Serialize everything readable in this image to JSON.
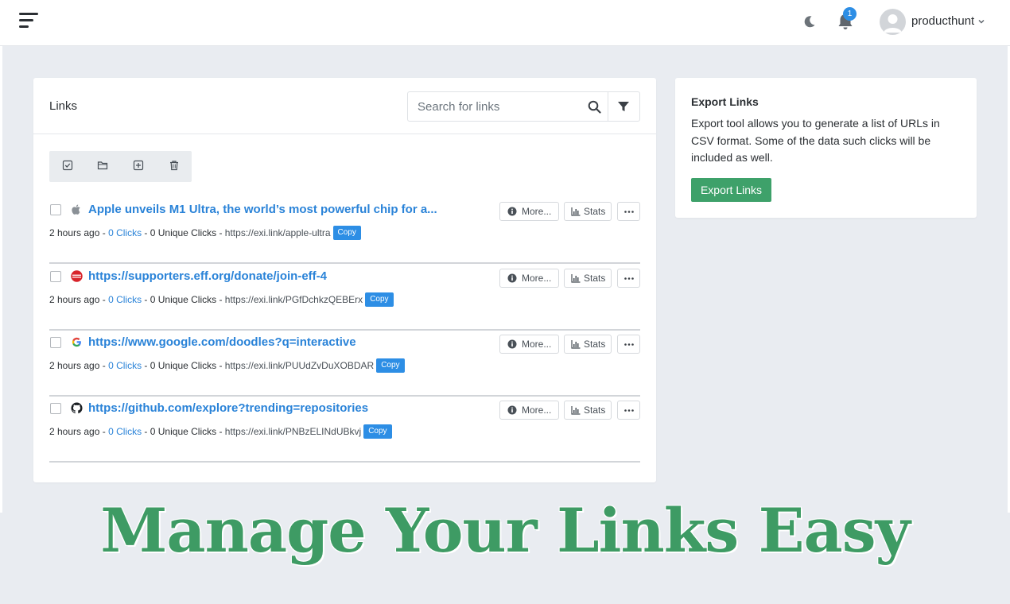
{
  "header": {
    "user_name": "producthunt",
    "notification_count": "1",
    "icons": [
      "menu-icon",
      "moon-icon",
      "bell-icon",
      "avatar",
      "chevron-down-icon"
    ]
  },
  "links_card": {
    "title": "Links",
    "search_placeholder": "Search for links",
    "toolbar_icons": [
      "select-all-icon",
      "folder-icon",
      "add-icon",
      "trash-icon"
    ]
  },
  "links": [
    {
      "title": "Apple unveils M1 Ultra, the world’s most powerful chip for a...",
      "favicon": "apple-icon",
      "time": "2 hours ago",
      "clicks": "0 Clicks",
      "unique": "0 Unique Clicks",
      "short_url": "https://exi.link/apple-ultra",
      "copy_label": "Copy",
      "more_label": "More...",
      "stats_label": "Stats"
    },
    {
      "title": "https://supporters.eff.org/donate/join-eff-4",
      "favicon": "eff-icon",
      "time": "2 hours ago",
      "clicks": "0 Clicks",
      "unique": "0 Unique Clicks",
      "short_url": "https://exi.link/PGfDchkzQEBErx",
      "copy_label": "Copy",
      "more_label": "More...",
      "stats_label": "Stats"
    },
    {
      "title": "https://www.google.com/doodles?q=interactive",
      "favicon": "google-icon",
      "time": "2 hours ago",
      "clicks": "0 Clicks",
      "unique": "0 Unique Clicks",
      "short_url": "https://exi.link/PUUdZvDuXOBDAR",
      "copy_label": "Copy",
      "more_label": "More...",
      "stats_label": "Stats"
    },
    {
      "title": "https://github.com/explore?trending=repositories",
      "favicon": "github-icon",
      "time": "2 hours ago",
      "clicks": "0 Clicks",
      "unique": "0 Unique Clicks",
      "short_url": "https://exi.link/PNBzELINdUBkvj",
      "copy_label": "Copy",
      "more_label": "More...",
      "stats_label": "Stats"
    }
  ],
  "export": {
    "title": "Export Links",
    "description": "Export tool allows you to generate a list of URLs in CSV format. Some of the data such clicks will be included as well.",
    "button_label": "Export Links"
  },
  "banner": {
    "text": "Manage Your Links Easy"
  },
  "colors": {
    "accent_blue": "#2d8ee5",
    "link_blue": "#2a83d8",
    "export_green": "#3ea16a",
    "banner_green": "#3e9b64",
    "page_bg": "#e9ecf1"
  }
}
